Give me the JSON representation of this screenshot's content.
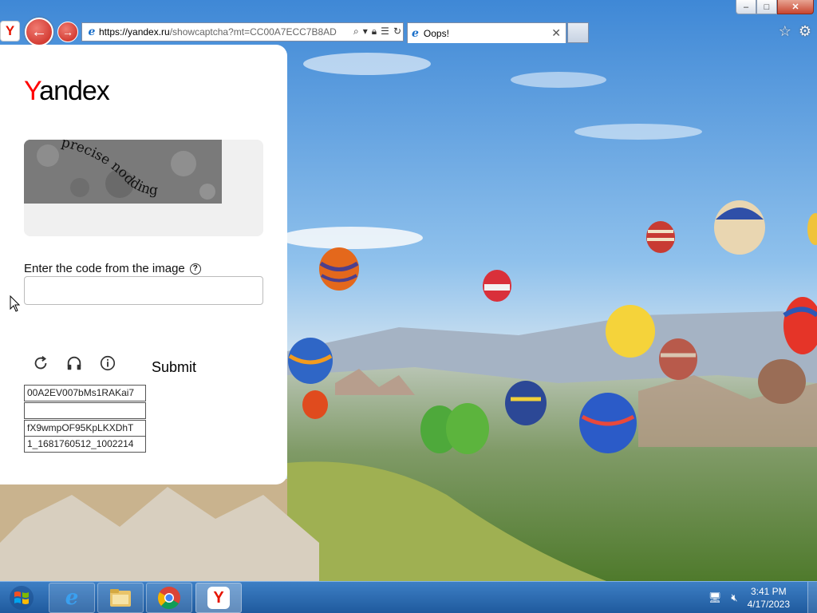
{
  "browser": {
    "url_host": "https://yandex.ru",
    "url_rest": "/showcaptcha?mt=CC00A7ECC7B8AD",
    "tab_title": "Oops!",
    "ie_icon": "e"
  },
  "page": {
    "brand_y": "Y",
    "brand_rest": "andex",
    "captcha_text": "precise nodding",
    "input_label": "Enter the code from the image",
    "input_value": "",
    "submit_label": "Submit",
    "tokens": [
      "00A2EV007bMs1RAKai7",
      "",
      "fX9wmpOF95KpLKXDhT",
      "1_1681760512_1002214"
    ]
  },
  "taskbar": {
    "time": "3:41 PM",
    "date": "4/17/2023",
    "apps": [
      "internet-explorer",
      "file-explorer",
      "chrome",
      "yandex-browser"
    ]
  },
  "colors": {
    "yandex_red": "#f00",
    "taskbar": "#2a6bb3"
  }
}
